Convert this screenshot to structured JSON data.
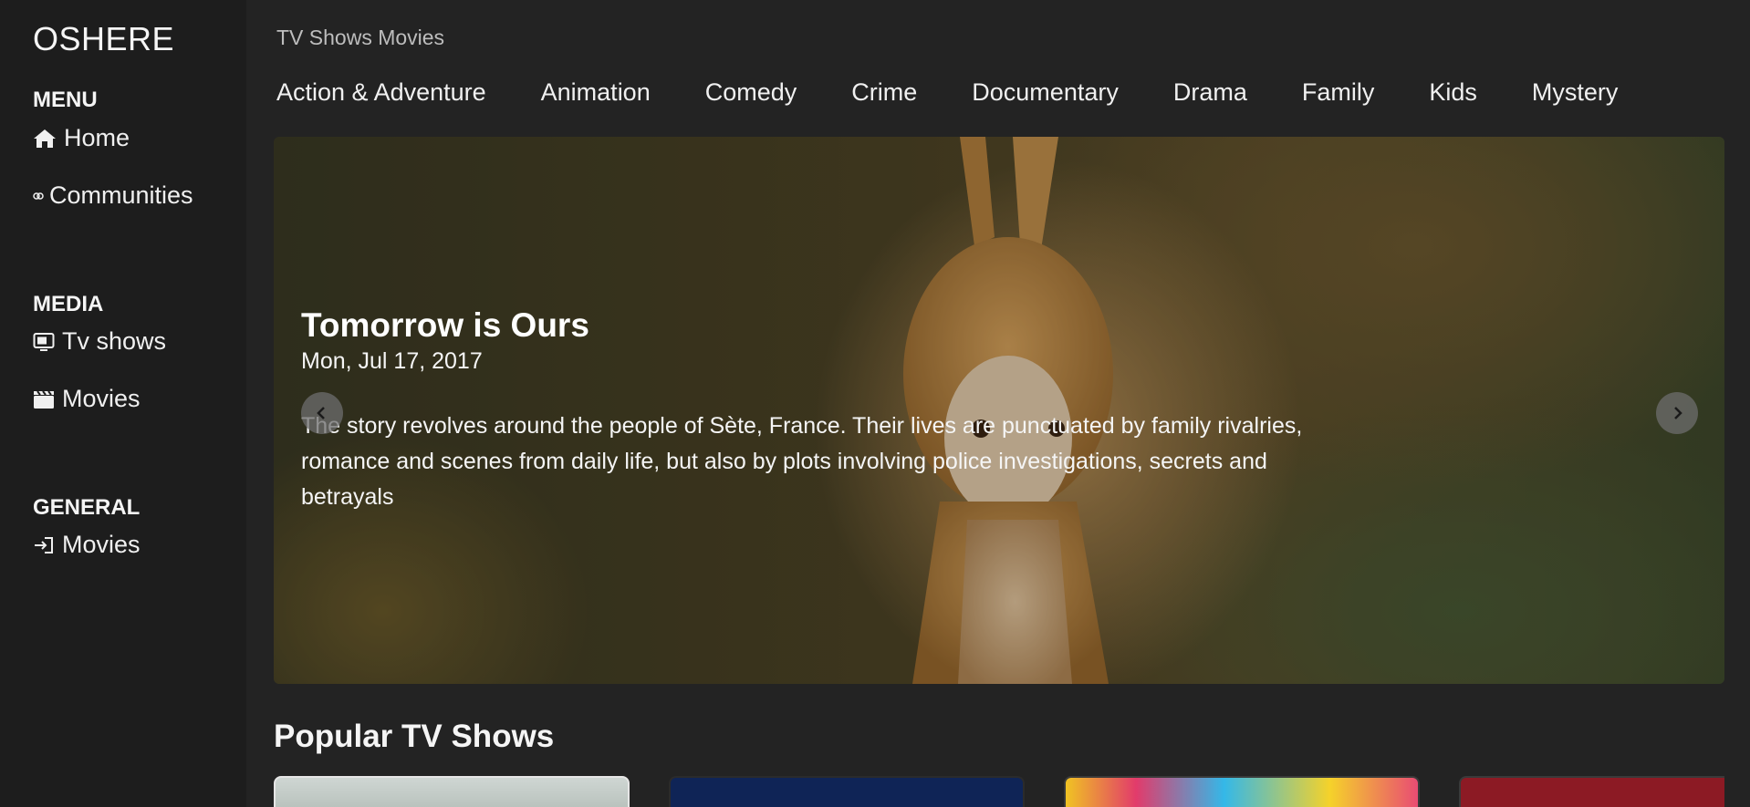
{
  "sidebar": {
    "brand": "OSHERE",
    "sections": [
      {
        "title": "MENU",
        "items": [
          {
            "label": "Home",
            "icon": "home-icon"
          },
          {
            "label": "Communities",
            "icon": "communities-icon"
          }
        ]
      },
      {
        "title": "MEDIA",
        "items": [
          {
            "label": "Tv shows",
            "icon": "tv-icon"
          },
          {
            "label": "Movies",
            "icon": "clapperboard-icon"
          }
        ]
      },
      {
        "title": "GENERAL",
        "items": [
          {
            "label": "Movies",
            "icon": "login-icon"
          }
        ]
      }
    ]
  },
  "topnav": {
    "label": "TV Shows Movies"
  },
  "genres": [
    "Action & Adventure",
    "Animation",
    "Comedy",
    "Crime",
    "Documentary",
    "Drama",
    "Family",
    "Kids",
    "Mystery"
  ],
  "hero": {
    "title": "Tomorrow is Ours",
    "date": "Mon, Jul 17, 2017",
    "description": "The story revolves around the people of Sète, France. Their lives are punctuated by family rivalries, romance and scenes from daily life, but also by plots involving police investigations, secrets and betrayals"
  },
  "popular": {
    "heading": "Popular TV Shows"
  },
  "colors": {
    "background": "#232323",
    "sidebar": "#1d1d1d",
    "text": "#f2f2f2"
  }
}
